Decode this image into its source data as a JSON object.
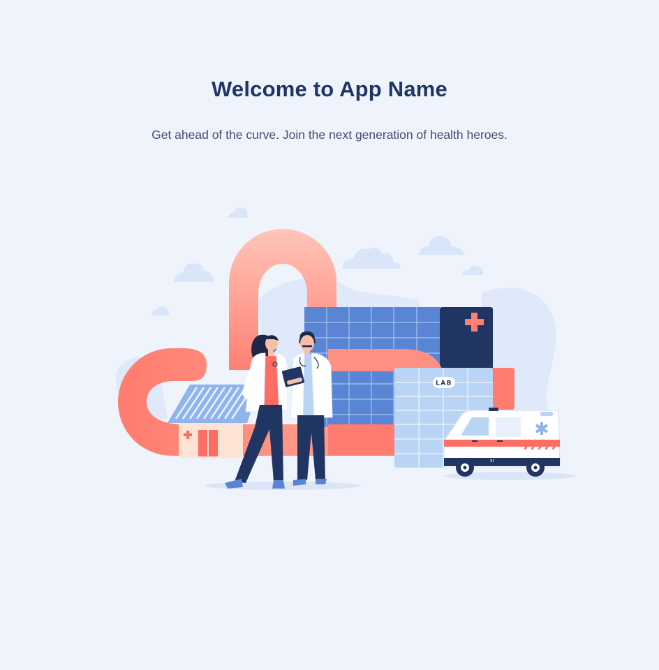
{
  "welcome": {
    "title": "Welcome to App Name",
    "subtitle": "Get ahead of the curve. Join the next generation of health heroes."
  },
  "illustration": {
    "lab_sign": "LAB",
    "ambulance_number": "91",
    "icons": [
      "cloud-icon",
      "hospital-building-icon",
      "medical-cross-icon",
      "lab-building-icon",
      "clinic-house-icon",
      "female-doctor-icon",
      "male-doctor-icon",
      "ambulance-icon",
      "star-of-life-icon"
    ]
  },
  "colors": {
    "background": "#eff4fc",
    "heading": "#1f3664",
    "text": "#3e4f6f",
    "accent_coral": "#ff8276",
    "accent_navy": "#213563",
    "accent_blue": "#5a85d4",
    "light_blue": "#b9d4f5"
  }
}
